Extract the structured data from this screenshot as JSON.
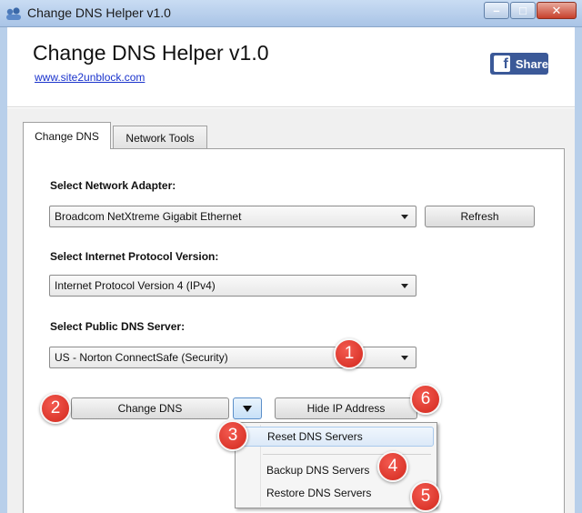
{
  "window": {
    "title": "Change DNS Helper v1.0",
    "minimize_glyph": "–",
    "maximize_glyph": "□",
    "close_glyph": "✕"
  },
  "header": {
    "app_title": "Change DNS Helper v1.0",
    "site_link": "www.site2unblock.com",
    "share_label": "Share",
    "share_icon_glyph": "f",
    "share_color": "#3b5998"
  },
  "tabs": [
    {
      "label": "Change DNS",
      "active": true
    },
    {
      "label": "Network Tools",
      "active": false
    }
  ],
  "adapter": {
    "label": "Select Network Adapter:",
    "value": "Broadcom NetXtreme Gigabit Ethernet",
    "refresh_label": "Refresh"
  },
  "protocol": {
    "label": "Select Internet Protocol Version:",
    "value": "Internet Protocol Version 4 (IPv4)"
  },
  "dns": {
    "label": "Select Public DNS Server:",
    "value": "US - Norton ConnectSafe (Security)"
  },
  "actions": {
    "change_dns_label": "Change DNS",
    "hide_ip_label": "Hide IP Address"
  },
  "menu": {
    "items": [
      {
        "label": "Reset DNS Servers"
      },
      {
        "label": "Backup DNS Servers"
      },
      {
        "label": "Restore DNS Servers"
      }
    ]
  },
  "badges": [
    "1",
    "2",
    "3",
    "4",
    "5",
    "6"
  ],
  "colors": {
    "badge": "#e2392e",
    "link": "#1a33cc",
    "titlebar": "#b9cfea"
  }
}
